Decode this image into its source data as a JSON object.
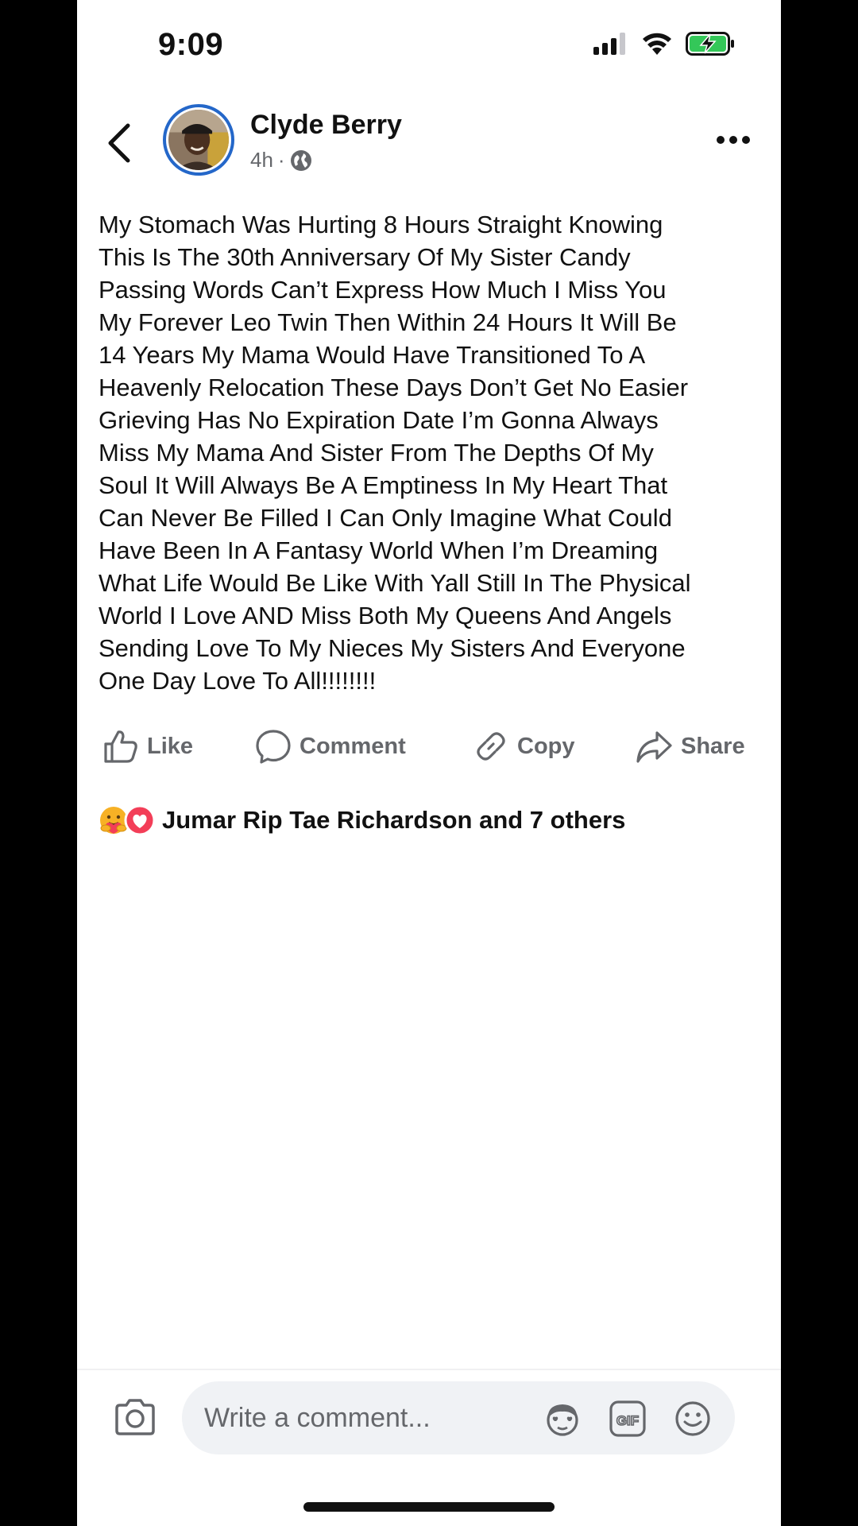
{
  "status_bar": {
    "time": "9:09"
  },
  "post": {
    "author": "Clyde Berry",
    "age": "4h",
    "separator": "·",
    "body": "My Stomach Was Hurting 8 Hours Straight Knowing\nThis Is The 30th Anniversary Of My Sister Candy\nPassing Words Can’t Express How Much I Miss You\nMy Forever Leo Twin Then Within 24 Hours It Will Be\n14 Years My Mama Would Have Transitioned To A\nHeavenly Relocation These Days Don’t Get No Easier\nGrieving Has No Expiration Date I’m Gonna Always\nMiss My Mama And Sister From The Depths Of My\nSoul It Will Always Be A Emptiness In My Heart That\nCan Never Be Filled I Can Only Imagine What Could\nHave Been In A Fantasy World When I’m Dreaming\nWhat Life Would Be Like With Yall Still In The Physical\nWorld I Love AND Miss Both My Queens And Angels\nSending Love To My Nieces My Sisters And Everyone\nOne Day Love To All!!!!!!!!"
  },
  "actions": {
    "like": "Like",
    "comment": "Comment",
    "copy": "Copy",
    "share": "Share"
  },
  "reactions": {
    "summary": "Jumar Rip Tae Richardson and 7 others",
    "icons": [
      "care-reaction-icon",
      "love-reaction-icon"
    ]
  },
  "composer": {
    "placeholder": "Write a comment..."
  },
  "colors": {
    "accent": "#2467c9",
    "secondary_text": "#65676b",
    "love": "#f33e58",
    "care": "#f7b125"
  }
}
